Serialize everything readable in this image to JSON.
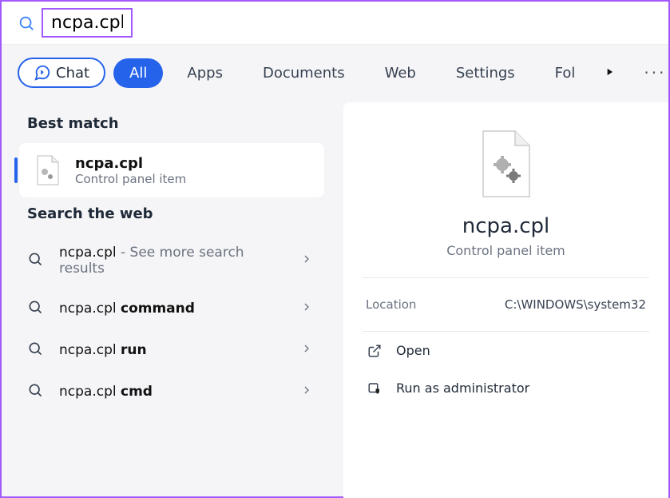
{
  "search": {
    "query": "ncpa.cpl"
  },
  "filters": {
    "chat": "Chat",
    "items": [
      "All",
      "Apps",
      "Documents",
      "Web",
      "Settings",
      "Fol"
    ],
    "active_index": 0
  },
  "left": {
    "best_match_heading": "Best match",
    "best_match": {
      "title": "ncpa.cpl",
      "subtitle": "Control panel item"
    },
    "web_heading": "Search the web",
    "web_results": [
      {
        "prefix": "ncpa.cpl",
        "suffix": " - See more search results",
        "bold_suffix": false
      },
      {
        "prefix": "ncpa.cpl ",
        "suffix": "command",
        "bold_suffix": true
      },
      {
        "prefix": "ncpa.cpl ",
        "suffix": "run",
        "bold_suffix": true
      },
      {
        "prefix": "ncpa.cpl ",
        "suffix": "cmd",
        "bold_suffix": true
      }
    ]
  },
  "detail": {
    "title": "ncpa.cpl",
    "subtitle": "Control panel item",
    "location_label": "Location",
    "location_value": "C:\\WINDOWS\\system32",
    "actions": {
      "open": "Open",
      "run_admin": "Run as administrator"
    }
  }
}
